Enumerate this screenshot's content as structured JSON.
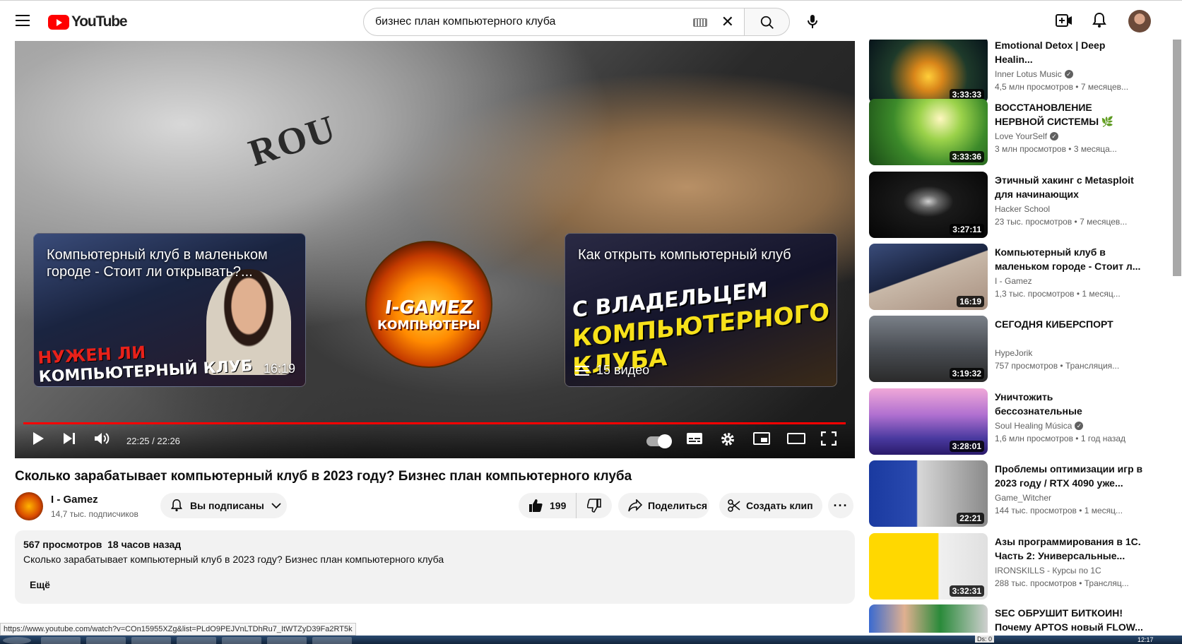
{
  "header": {
    "logo_text": "YouTube",
    "search_value": "бизнес план компьютерного клуба"
  },
  "player": {
    "shirt_text": "ROU",
    "endcard_left": {
      "title": "Компьютерный клуб в маленьком городе - Стоит ли открывать?...",
      "overlay_line1": "НУЖЕН ЛИ",
      "overlay_line2": "КОМПЬЮТЕРНЫЙ КЛУБ",
      "duration": "16:19"
    },
    "channel_logo": {
      "line1": "I-GAMEZ",
      "line2": "КОМПЬЮТЕРЫ"
    },
    "endcard_right": {
      "title": "Как открыть компьютерный клуб",
      "overlay_line1": "С ВЛАДЕЛЬЦЕМ",
      "overlay_line2": "КОМПЬЮТЕРНОГО",
      "overlay_line3": "КЛУБА",
      "playlist_count": "15 видео"
    },
    "time": "22:25 / 22:26",
    "progress_fraction": 0.999
  },
  "video": {
    "title": "Сколько зарабатывает компьютерный клуб в 2023 году? Бизнес план компьютерного клуба",
    "channel": "I - Gamez",
    "subscribers": "14,7 тыс. подписчиков",
    "subscribe_label": "Вы подписаны",
    "likes": "199",
    "share_label": "Поделиться",
    "clip_label": "Создать клип",
    "more_label": "···"
  },
  "description": {
    "views": "567 просмотров",
    "date": "18 часов назад",
    "text": "Сколько зарабатывает компьютерный клуб в 2023 году? Бизнес план компьютерного клуба",
    "more": "Ещё"
  },
  "recommendations": [
    {
      "title": "Emotional Detox | Deep Healin...",
      "channel": "Inner Lotus Music",
      "verified": true,
      "stats": "4,5 млн просмотров • 7 месяцев...",
      "duration": "3:33:33",
      "thumb": "tree-gold"
    },
    {
      "title": "ВОССТАНОВЛЕНИЕ НЕРВНОЙ СИСТЕМЫ 🌿 Нежная музык...",
      "channel": "Love YourSelf",
      "verified": true,
      "stats": "3 млн просмотров • 3 месяца...",
      "duration": "3:33:36",
      "thumb": "tree-green"
    },
    {
      "title": "Этичный хакинг с Metasploit для начинающих",
      "channel": "Hacker School",
      "verified": false,
      "stats": "23 тыс. просмотров • 7 месяцев...",
      "duration": "3:27:11",
      "thumb": "hacker"
    },
    {
      "title": "Компьютерный клуб в маленьком городе - Стоит л...",
      "channel": "I - Gamez",
      "verified": false,
      "stats": "1,3 тыс. просмотров • 1 месяц...",
      "duration": "16:19",
      "thumb": "club"
    },
    {
      "title": "СЕГОДНЯ КИБЕРСПОРТ",
      "channel": "HypeJorik",
      "verified": false,
      "stats": "757 просмотров • Трансляция...",
      "duration": "3:19:32",
      "thumb": "pubg"
    },
    {
      "title": "Уничтожить бессознательные блокировки и негатив |...",
      "channel": "Soul Healing Música",
      "verified": true,
      "stats": "1,6 млн просмотров • 1 год назад",
      "duration": "3:28:01",
      "thumb": "chains"
    },
    {
      "title": "Проблемы оптимизации игр в 2023 году / RTX 4090 уже...",
      "channel": "Game_Witcher",
      "verified": false,
      "stats": "144 тыс. просмотров • 1 месяц...",
      "duration": "22:21",
      "thumb": "optim"
    },
    {
      "title": "Азы программирования в 1С. Часть 2: Универсальные...",
      "channel": "IRONSKILLS - Курсы по 1С",
      "verified": false,
      "stats": "288 тыс. просмотров • Трансляц...",
      "duration": "3:32:31",
      "thumb": "onec"
    },
    {
      "title": "SEC ОБРУШИТ БИТКОИН! Почему APTOS новый FLOW...",
      "channel": "",
      "verified": false,
      "stats": "",
      "duration": "",
      "thumb": "crypto"
    }
  ],
  "statusbar": {
    "url": "https://www.youtube.com/watch?v=COn15955XZg&list=PLdO9PEJVnLTDhRu7_ItWTZyD39Fa2RT5k"
  },
  "taskbar": {
    "tray_label": "Ds: 0",
    "clock": "12:17"
  },
  "colors": {
    "accent": "#ff0000",
    "chip_bg": "#f2f2f2",
    "secondary_text": "#606060"
  }
}
